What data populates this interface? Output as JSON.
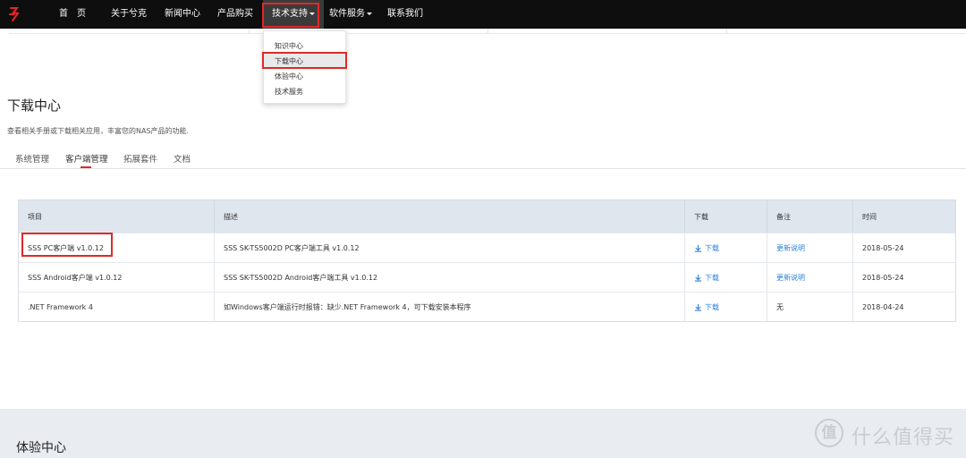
{
  "nav": {
    "items": [
      {
        "label": "首　页"
      },
      {
        "label": "关于兮克"
      },
      {
        "label": "新闻中心"
      },
      {
        "label": "产品购买"
      },
      {
        "label": "技术支持"
      },
      {
        "label": "软件服务"
      },
      {
        "label": "联系我们"
      }
    ]
  },
  "dropdown": {
    "items": [
      {
        "label": "知识中心"
      },
      {
        "label": "下载中心"
      },
      {
        "label": "体验中心"
      },
      {
        "label": "技术服务"
      }
    ]
  },
  "page": {
    "title": "下载中心",
    "description": "查看相关手册或下载相关应用，丰富您的NAS产品的功能."
  },
  "tabs": [
    {
      "label": "系统管理"
    },
    {
      "label": "客户端管理"
    },
    {
      "label": "拓展套件"
    },
    {
      "label": "文档"
    }
  ],
  "table": {
    "headers": {
      "item": "项目",
      "desc": "描述",
      "download": "下载",
      "note": "备注",
      "time": "时间"
    },
    "rows": [
      {
        "item": "SSS PC客户端 v1.0.12",
        "desc": "SSS SK-TS5002D PC客户端工具 v1.0.12",
        "download": "下载",
        "note": "更新说明",
        "time": "2018-05-24"
      },
      {
        "item": "SSS Android客户端 v1.0.12",
        "desc": "SSS SK-TS5002D Android客户端工具 v1.0.12",
        "download": "下载",
        "note": "更新说明",
        "time": "2018-05-24"
      },
      {
        "item": ".NET Framework 4",
        "desc": "如Windows客户端运行时报错：缺少.NET Framework 4，可下载安装本程序",
        "download": "下载",
        "note": "无",
        "time": "2018-04-24"
      }
    ]
  },
  "bottom": {
    "title": "体验中心"
  },
  "watermark": {
    "glyph": "值",
    "text": "什么值得买"
  },
  "colors": {
    "nav_bg": "#0e0e0e",
    "highlight": "#e02828",
    "link": "#2e7fd6",
    "table_header": "#dfe6ee"
  }
}
